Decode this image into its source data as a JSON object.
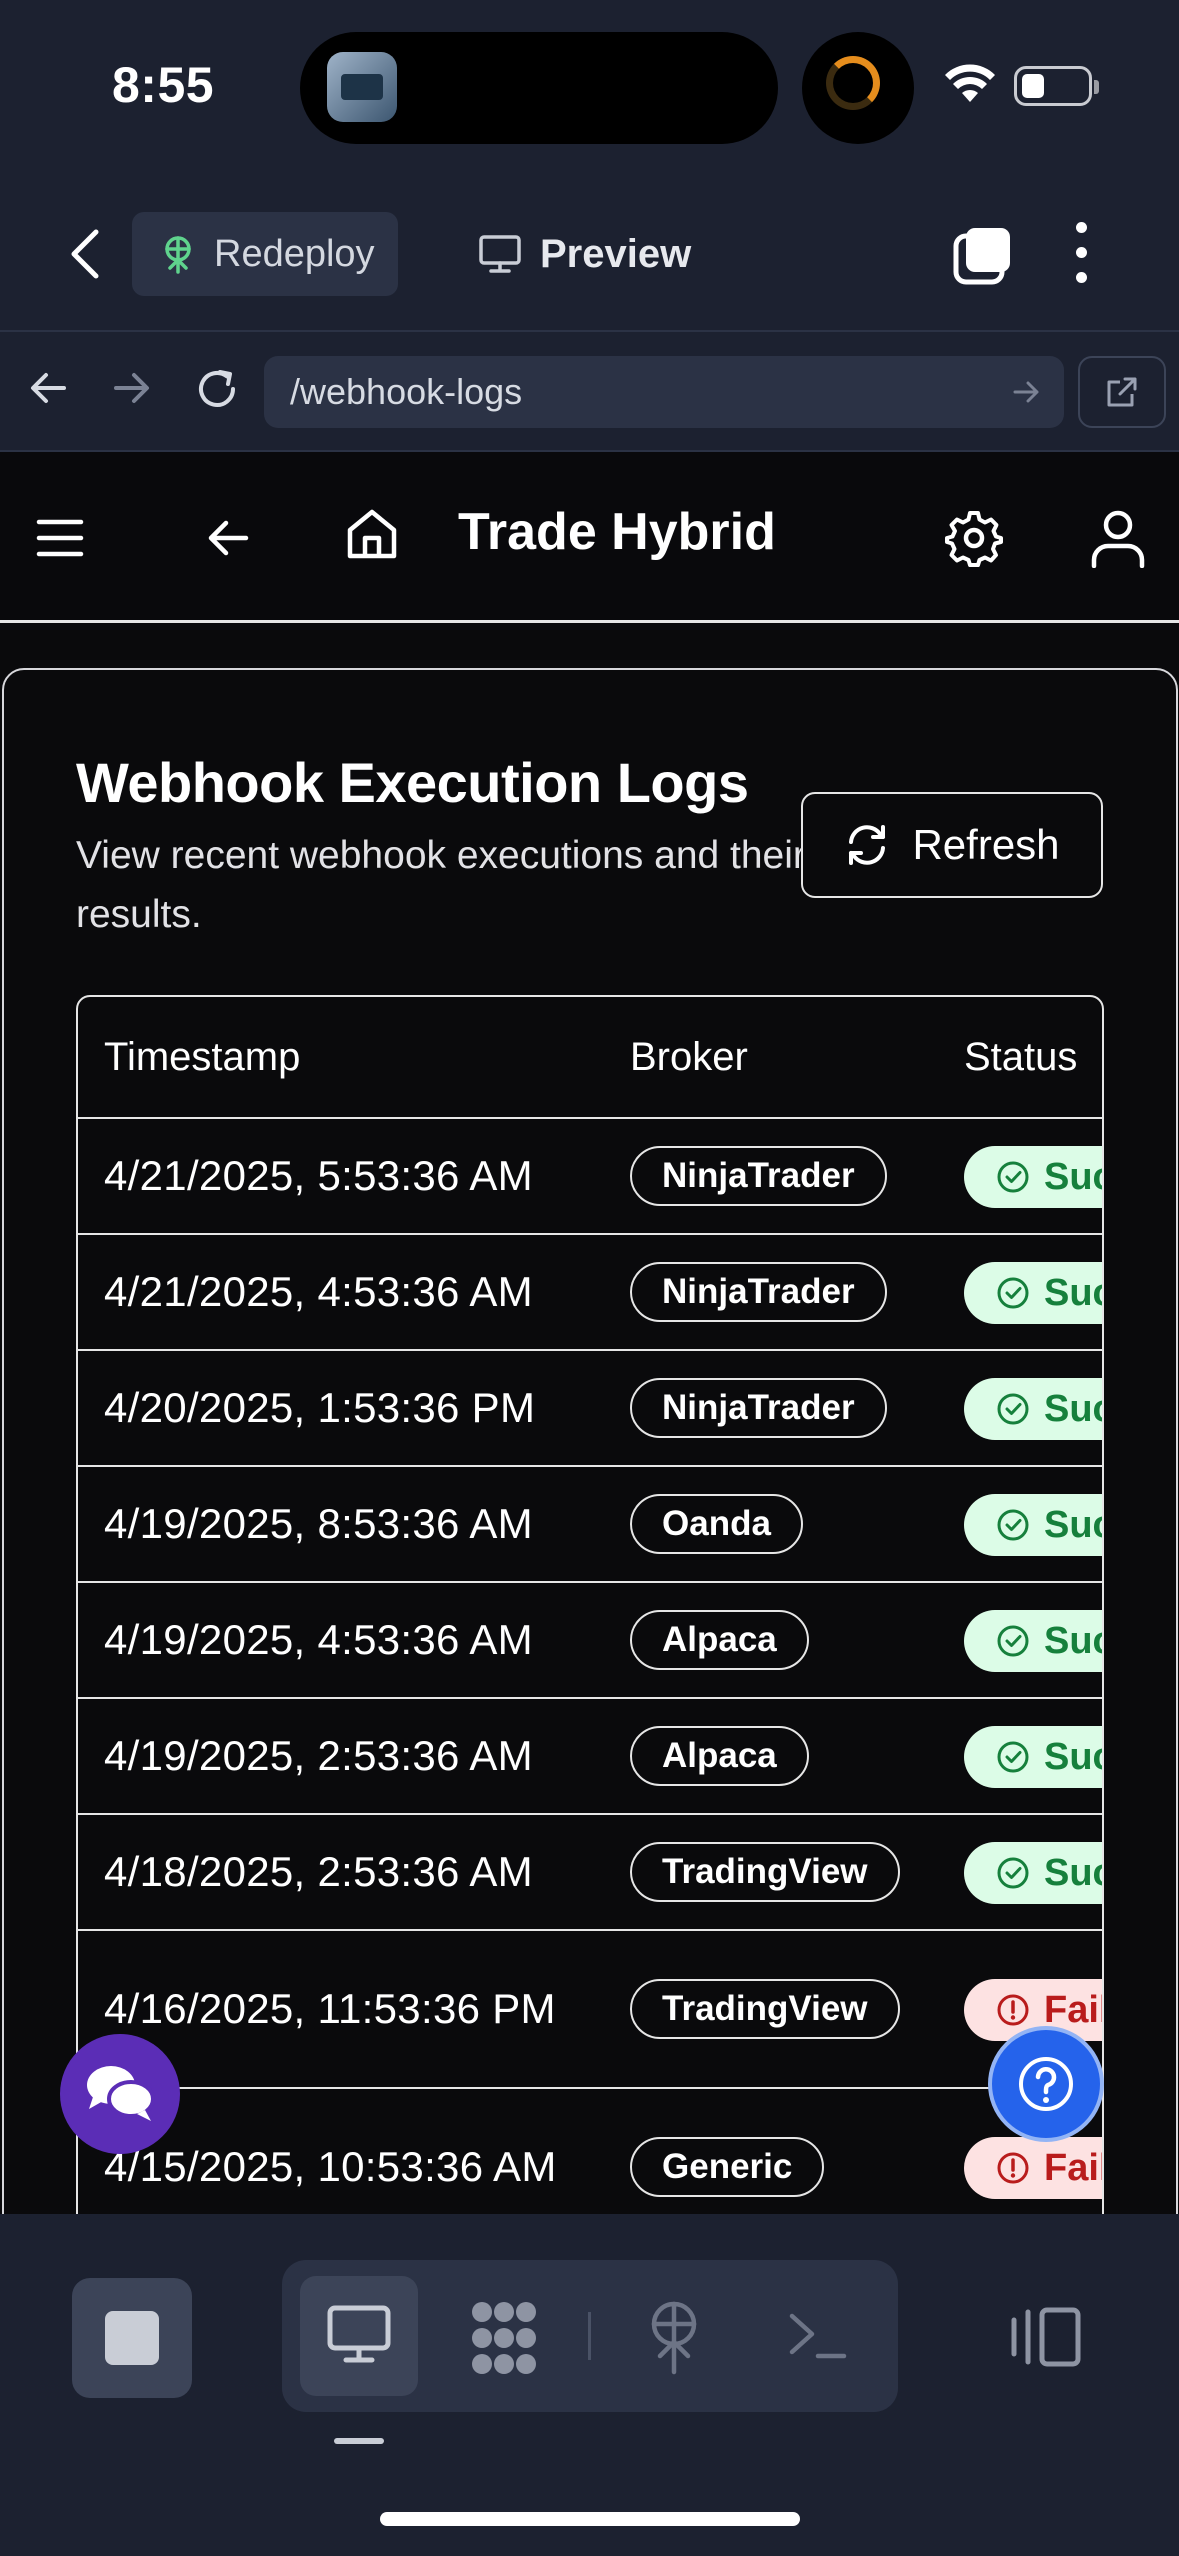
{
  "status_bar": {
    "time": "8:55"
  },
  "app_header": {
    "redeploy_label": "Redeploy",
    "preview_label": "Preview"
  },
  "browser": {
    "url": "/webhook-logs"
  },
  "site": {
    "title": "Trade Hybrid"
  },
  "logs": {
    "title": "Webhook Execution Logs",
    "subtitle": "View recent webhook executions and their results.",
    "refresh_label": "Refresh",
    "columns": [
      "Timestamp",
      "Broker",
      "Status"
    ],
    "rows": [
      {
        "timestamp": "4/21/2025, 5:53:36 AM",
        "broker": "NinjaTrader",
        "status": "Suc",
        "state": "success"
      },
      {
        "timestamp": "4/21/2025, 4:53:36 AM",
        "broker": "NinjaTrader",
        "status": "Suc",
        "state": "success"
      },
      {
        "timestamp": "4/20/2025, 1:53:36 PM",
        "broker": "NinjaTrader",
        "status": "Suc",
        "state": "success"
      },
      {
        "timestamp": "4/19/2025, 8:53:36 AM",
        "broker": "Oanda",
        "status": "Suc",
        "state": "success"
      },
      {
        "timestamp": "4/19/2025, 4:53:36 AM",
        "broker": "Alpaca",
        "status": "Suc",
        "state": "success"
      },
      {
        "timestamp": "4/19/2025, 2:53:36 AM",
        "broker": "Alpaca",
        "status": "Suc",
        "state": "success"
      },
      {
        "timestamp": "4/18/2025, 2:53:36 AM",
        "broker": "TradingView",
        "status": "Suc",
        "state": "success"
      },
      {
        "timestamp": "4/16/2025, 11:53:36 PM",
        "broker": "TradingView",
        "status": "Fail",
        "state": "failed"
      },
      {
        "timestamp": "4/15/2025, 10:53:36 AM",
        "broker": "Generic",
        "status": "Fail",
        "state": "failed"
      }
    ]
  },
  "icons": {
    "status_success": "check-circle-icon",
    "status_failed": "alert-circle-icon"
  },
  "colors": {
    "chrome_bg": "#1c2130",
    "page_bg": "#0a0a0c",
    "success_bg": "#dcfce7",
    "success_fg": "#16803c",
    "fail_bg": "#fde2e2",
    "fail_fg": "#b91c1c",
    "chat_fab": "#5b2db6",
    "help_fab": "#2563eb"
  }
}
